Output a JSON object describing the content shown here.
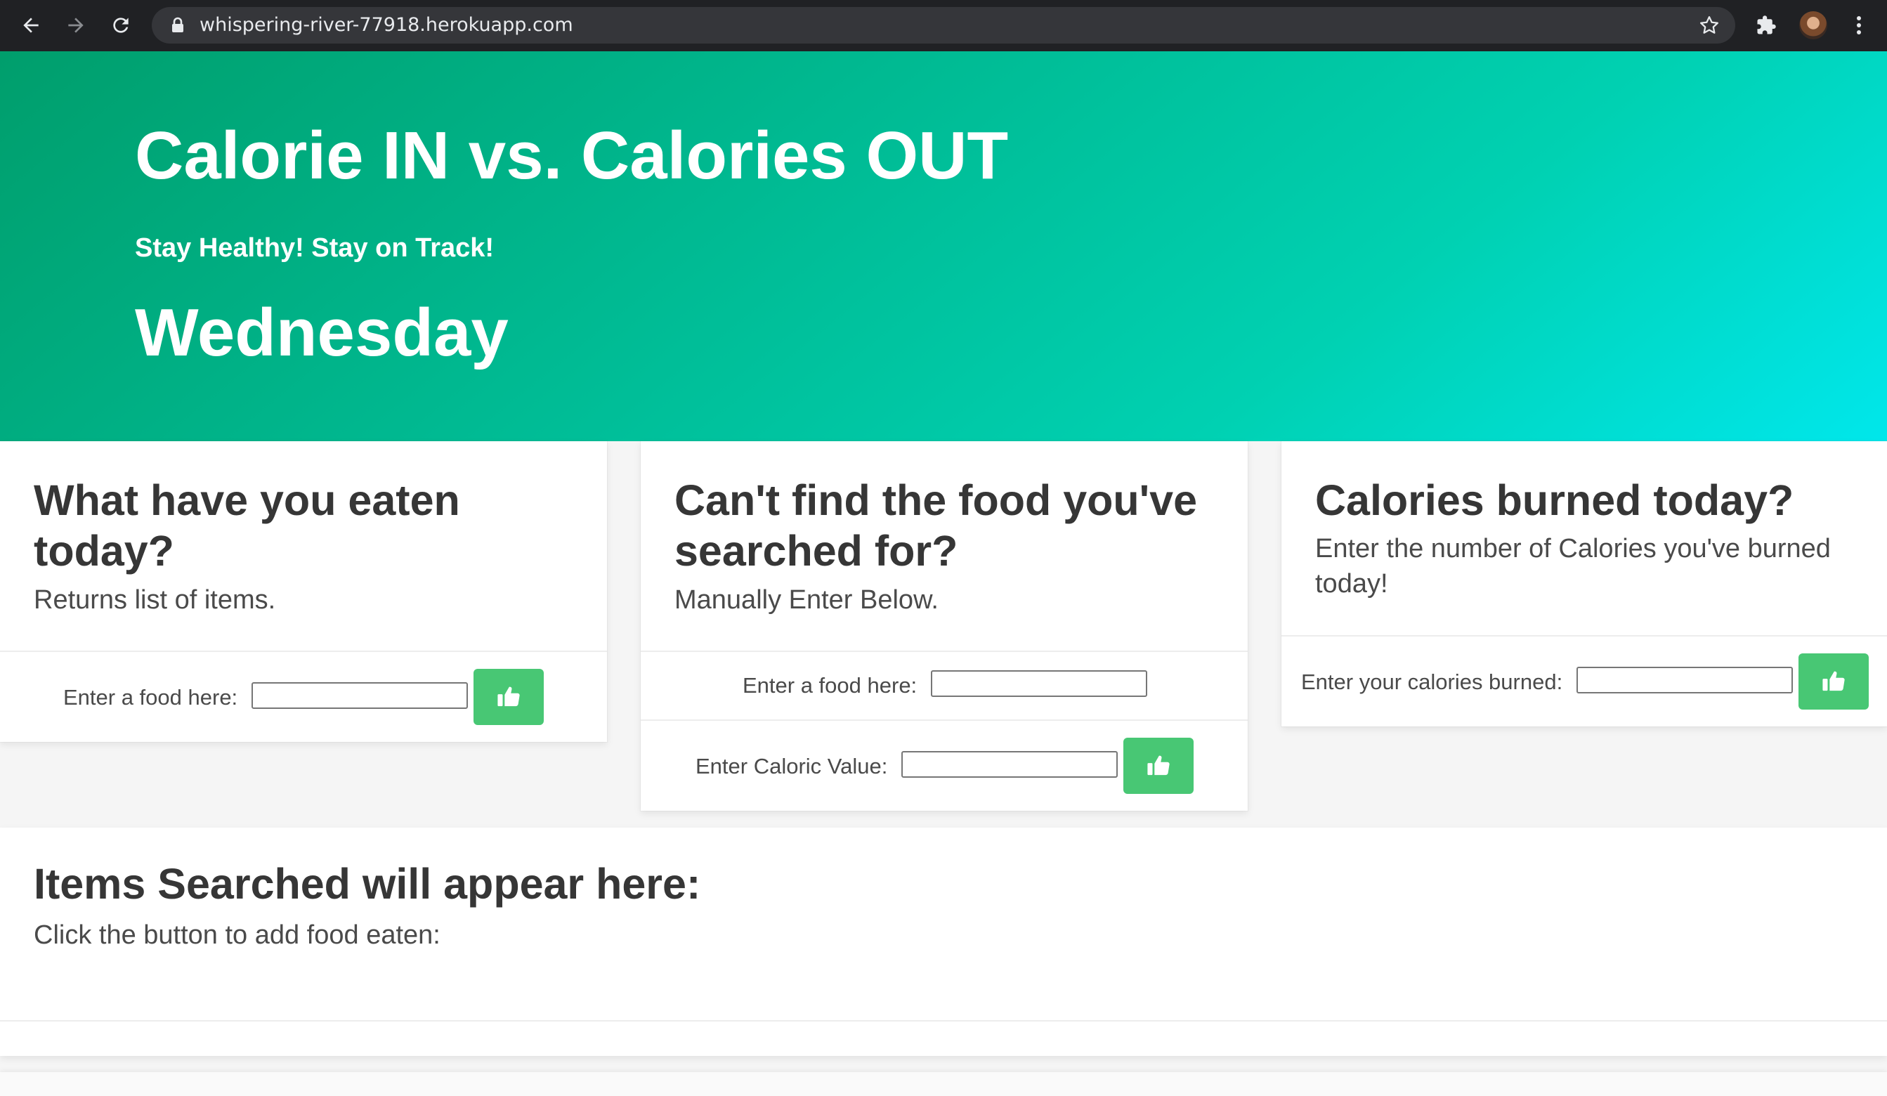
{
  "browser": {
    "url": "whispering-river-77918.herokuapp.com",
    "icons": [
      "back-icon",
      "forward-icon",
      "reload-icon",
      "lock-icon",
      "star-icon",
      "extensions-icon",
      "avatar",
      "menu-icon"
    ]
  },
  "hero": {
    "title": "Calorie IN vs. Calories OUT",
    "subtitle": "Stay Healthy! Stay on Track!",
    "day": "Wednesday"
  },
  "eaten_card": {
    "title": "What have you eaten today?",
    "subtitle": "Returns list of items.",
    "food_label": "Enter a food here:",
    "food_value": ""
  },
  "manual_card": {
    "title": "Can't find the food you've searched for?",
    "subtitle": "Manually Enter Below.",
    "food_label": "Enter a food here:",
    "food_value": "",
    "calorie_label": "Enter Caloric Value:",
    "calorie_value": ""
  },
  "burned_card": {
    "title": "Calories burned today?",
    "subtitle": "Enter the number of Calories you've burned today!",
    "burned_label": "Enter your calories burned:",
    "burned_value": ""
  },
  "results": {
    "title": "Items Searched will appear here:",
    "subtitle": "Click the button to add food eaten:"
  },
  "colors": {
    "hero_gradient": [
      "#009e6c",
      "#00d1b2",
      "#00e7eb"
    ],
    "button": "#48c774",
    "chrome": "#202124"
  }
}
